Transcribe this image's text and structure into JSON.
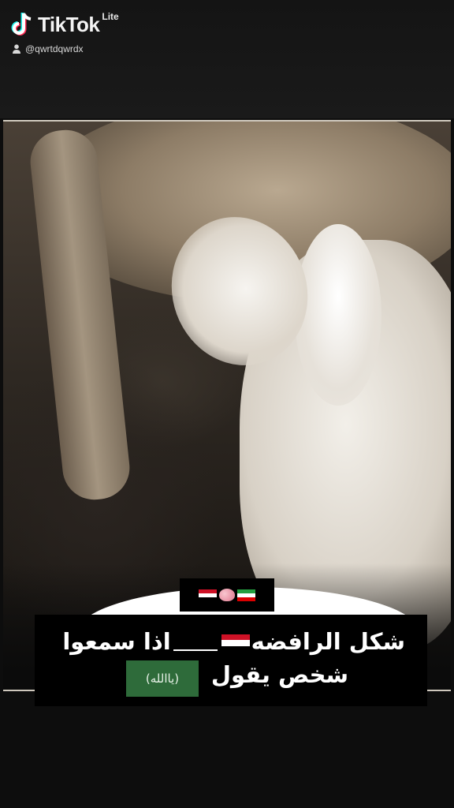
{
  "header": {
    "brand": "TikTok",
    "brand_suffix": "Lite",
    "username": "@qwrtdqwrdx",
    "logo_icon": "tiktok-note-icon",
    "user_icon": "person-icon"
  },
  "video": {
    "flags_row": [
      "iraq-flag",
      "brain-emoji",
      "iran-flag"
    ],
    "caption_line1_a": "شكل الرافضه",
    "caption_line1_b": "اذا سمعوا",
    "caption_line2": "شخص يقول",
    "badge_text": "(ياالله)"
  },
  "colors": {
    "background": "#0d0d0d",
    "badge_green": "#2e6b3a",
    "iraq_red": "#ce1126",
    "iraq_black": "#000000",
    "iran_green": "#239f40",
    "iran_red": "#da0000"
  }
}
